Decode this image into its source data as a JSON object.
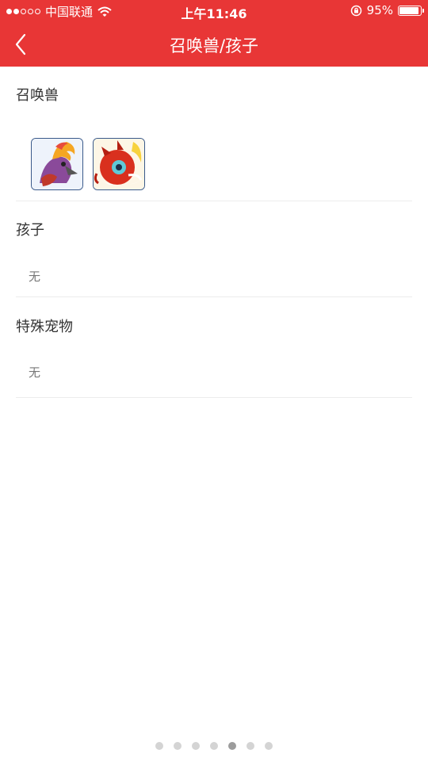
{
  "status_bar": {
    "carrier": "中国联通",
    "time": "上午11:46",
    "battery_percent": "95%",
    "battery_level": 0.95,
    "signal_bars_filled": 2,
    "signal_bars_total": 5
  },
  "navbar": {
    "title": "召唤兽/孩子",
    "back_icon": "chevron-left-icon"
  },
  "sections": [
    {
      "label": "召唤兽",
      "items": [
        "summon-phoenix-avatar",
        "summon-red-beast-avatar"
      ]
    },
    {
      "label": "孩子",
      "value": "无"
    },
    {
      "label": "特殊宠物",
      "value": "无"
    }
  ],
  "pager": {
    "count": 7,
    "active_index": 4
  },
  "colors": {
    "header": "#e83636",
    "divider": "#ececec",
    "pager_dot": "#d4d4d4",
    "pager_active": "#9c9c9c"
  }
}
